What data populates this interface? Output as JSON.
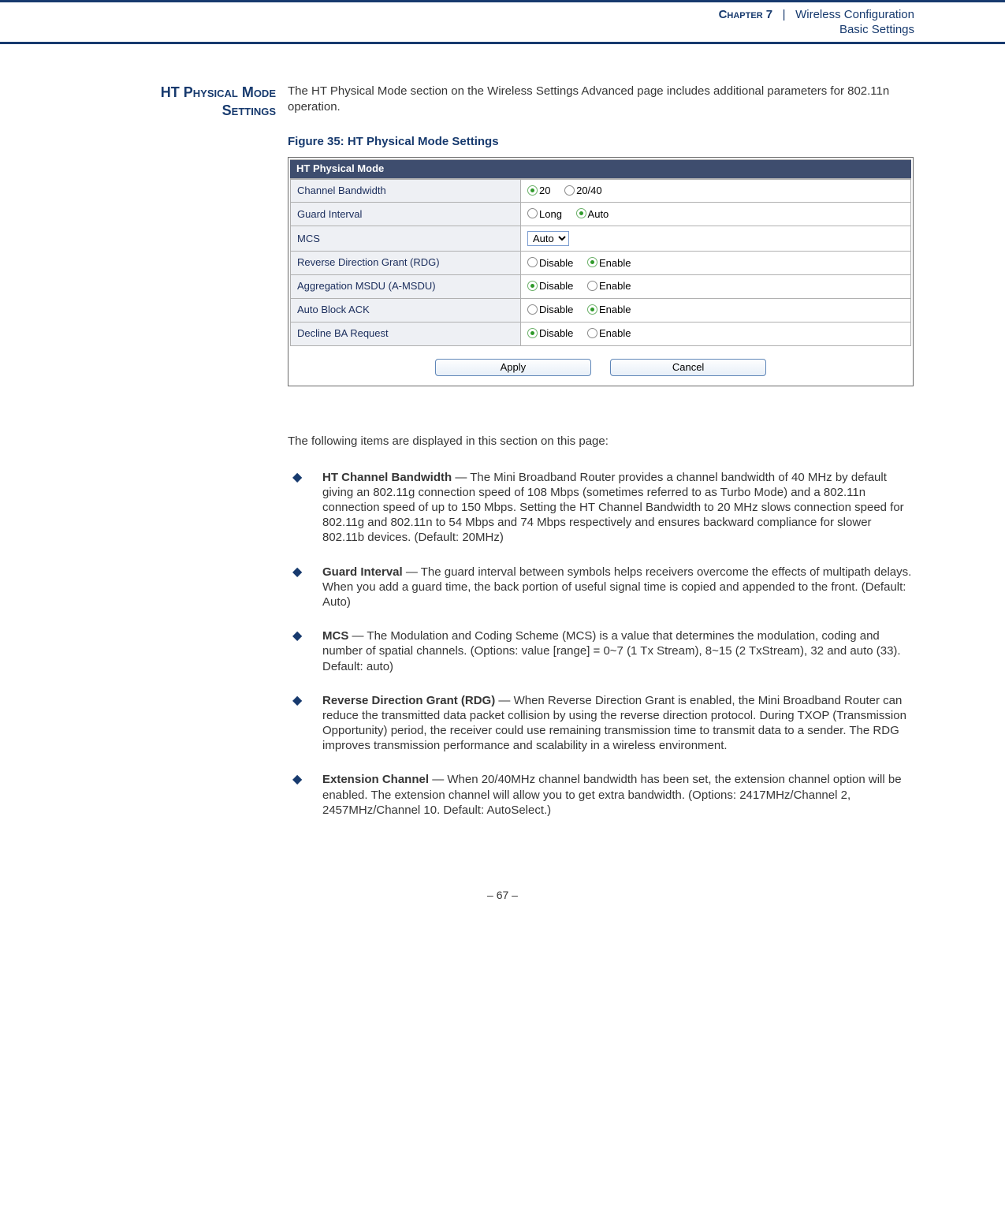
{
  "header": {
    "chapter_label": "Chapter 7",
    "sep": "|",
    "section": "Wireless Configuration",
    "subsection": "Basic Settings"
  },
  "side_heading": {
    "l1": "HT Physical Mode",
    "l2": "Settings"
  },
  "intro": "The HT Physical Mode section on the Wireless Settings Advanced page includes additional parameters for 802.11n operation.",
  "figure_caption": "Figure 35:  HT Physical Mode Settings",
  "screenshot": {
    "title": "HT Physical Mode",
    "rows": {
      "channel_bandwidth": {
        "label": "Channel Bandwidth",
        "opt1": "20",
        "opt2": "20/40",
        "selected": "20"
      },
      "guard_interval": {
        "label": "Guard Interval",
        "opt1": "Long",
        "opt2": "Auto",
        "selected": "Auto"
      },
      "mcs": {
        "label": "MCS",
        "value": "Auto"
      },
      "rdg": {
        "label": "Reverse Direction Grant (RDG)",
        "opt1": "Disable",
        "opt2": "Enable",
        "selected": "Enable"
      },
      "amsdu": {
        "label": "Aggregation MSDU (A-MSDU)",
        "opt1": "Disable",
        "opt2": "Enable",
        "selected": "Disable"
      },
      "auto_block_ack": {
        "label": "Auto Block ACK",
        "opt1": "Disable",
        "opt2": "Enable",
        "selected": "Enable"
      },
      "decline_ba": {
        "label": "Decline BA Request",
        "opt1": "Disable",
        "opt2": "Enable",
        "selected": "Disable"
      }
    },
    "buttons": {
      "apply": "Apply",
      "cancel": "Cancel"
    }
  },
  "section_lead": "The following items are displayed in this section on this page:",
  "bullets": [
    {
      "term": "HT Channel Bandwidth",
      "text": " — The Mini Broadband Router provides a channel bandwidth of 40 MHz by default giving an 802.11g connection speed of 108 Mbps (sometimes referred to as Turbo Mode) and a 802.11n connection speed of up to 150 Mbps. Setting the HT Channel Bandwidth to 20 MHz slows connection speed for 802.11g and 802.11n to 54 Mbps and 74 Mbps respectively and ensures backward compliance for slower 802.11b devices. (Default: 20MHz)"
    },
    {
      "term": "Guard Interval",
      "text": " — The guard interval between symbols helps receivers overcome the effects of multipath delays. When you add a guard time, the back portion of useful signal time is copied and appended to the front. (Default: Auto)"
    },
    {
      "term": "MCS",
      "text": " — The Modulation and Coding Scheme (MCS) is a value that determines the modulation, coding and number of spatial channels. (Options: value [range] = 0~7 (1 Tx Stream), 8~15 (2 TxStream), 32 and auto (33). Default: auto)"
    },
    {
      "term": "Reverse Direction Grant (RDG)",
      "text": " — When Reverse Direction Grant is enabled, the Mini Broadband Router can reduce the transmitted data packet collision by using the reverse direction protocol. During TXOP (Transmission Opportunity) period, the receiver could use remaining transmission time to transmit data to a sender. The RDG improves transmission performance and scalability in a wireless environment."
    },
    {
      "term": "Extension Channel",
      "text": " — When 20/40MHz channel bandwidth has been set, the extension channel option will be enabled. The extension channel will allow you to get extra bandwidth. (Options: 2417MHz/Channel 2, 2457MHz/Channel 10. Default: AutoSelect.)"
    }
  ],
  "footer": "–  67  –"
}
